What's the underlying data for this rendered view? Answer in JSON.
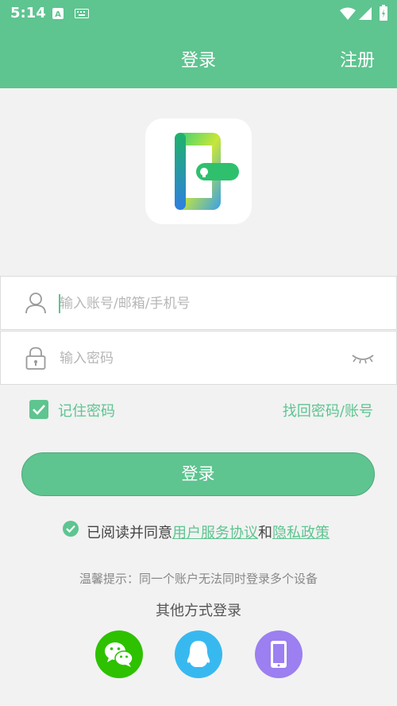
{
  "status_bar": {
    "time": "5:14"
  },
  "header": {
    "title": "登录",
    "register": "注册"
  },
  "form": {
    "account_placeholder": "输入账号/邮箱/手机号",
    "password_placeholder": "输入密码",
    "remember_label": "记住密码",
    "find_link": "找回密码/账号",
    "login_button": "登录"
  },
  "agreement": {
    "prefix": "已阅读并同意",
    "user_agreement": "用户服务协议",
    "connector": "和",
    "privacy_policy": "隐私政策"
  },
  "tip": "温馨提示：同一个账户无法同时登录多个设备",
  "other_login": "其他方式登录",
  "colors": {
    "brand": "#5ec490",
    "wechat": "#2dc100",
    "qq": "#37b9f0",
    "phone": "#9c7ff0"
  },
  "icons": {
    "account": "user-icon",
    "password": "lock-icon",
    "toggle": "eye-closed-icon",
    "social": [
      "wechat-icon",
      "qq-icon",
      "phone-icon"
    ]
  }
}
